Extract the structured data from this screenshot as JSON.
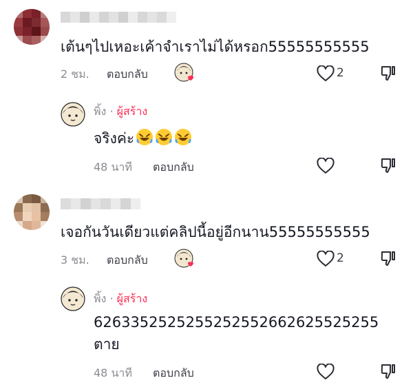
{
  "comments": [
    {
      "text": "เต้นๆไปเหอะเค้าจำเราไม่ได้หรอก55555555555",
      "time": "2 ชม.",
      "reply_label": "ตอบกลับ",
      "likes": "2",
      "reply": {
        "author": "พิ้ง",
        "separator": "·",
        "creator_label": "ผู้สร้าง",
        "text": "จริงค่ะ",
        "emoji": [
          "rolling-laughing-emoji",
          "rolling-laughing-emoji",
          "rolling-laughing-emoji"
        ],
        "time": "48 นาที",
        "reply_label": "ตอบกลับ"
      }
    },
    {
      "text": "เจอกันวันเดียวแต่คลิปนี้อยู่อีกนาน55555555555",
      "time": "3 ชม.",
      "reply_label": "ตอบกลับ",
      "likes": "2",
      "reply": {
        "author": "พิ้ง",
        "separator": "·",
        "creator_label": "ผู้สร้าง",
        "text_line1": "6263352525255252552662625525255",
        "text_line2": "ตาย",
        "time": "48 นาที",
        "reply_label": "ตอบกลับ"
      }
    }
  ],
  "colors": {
    "creator": "#fe2c55",
    "meta": "#8a8b91",
    "heart": "#fe2c55"
  }
}
